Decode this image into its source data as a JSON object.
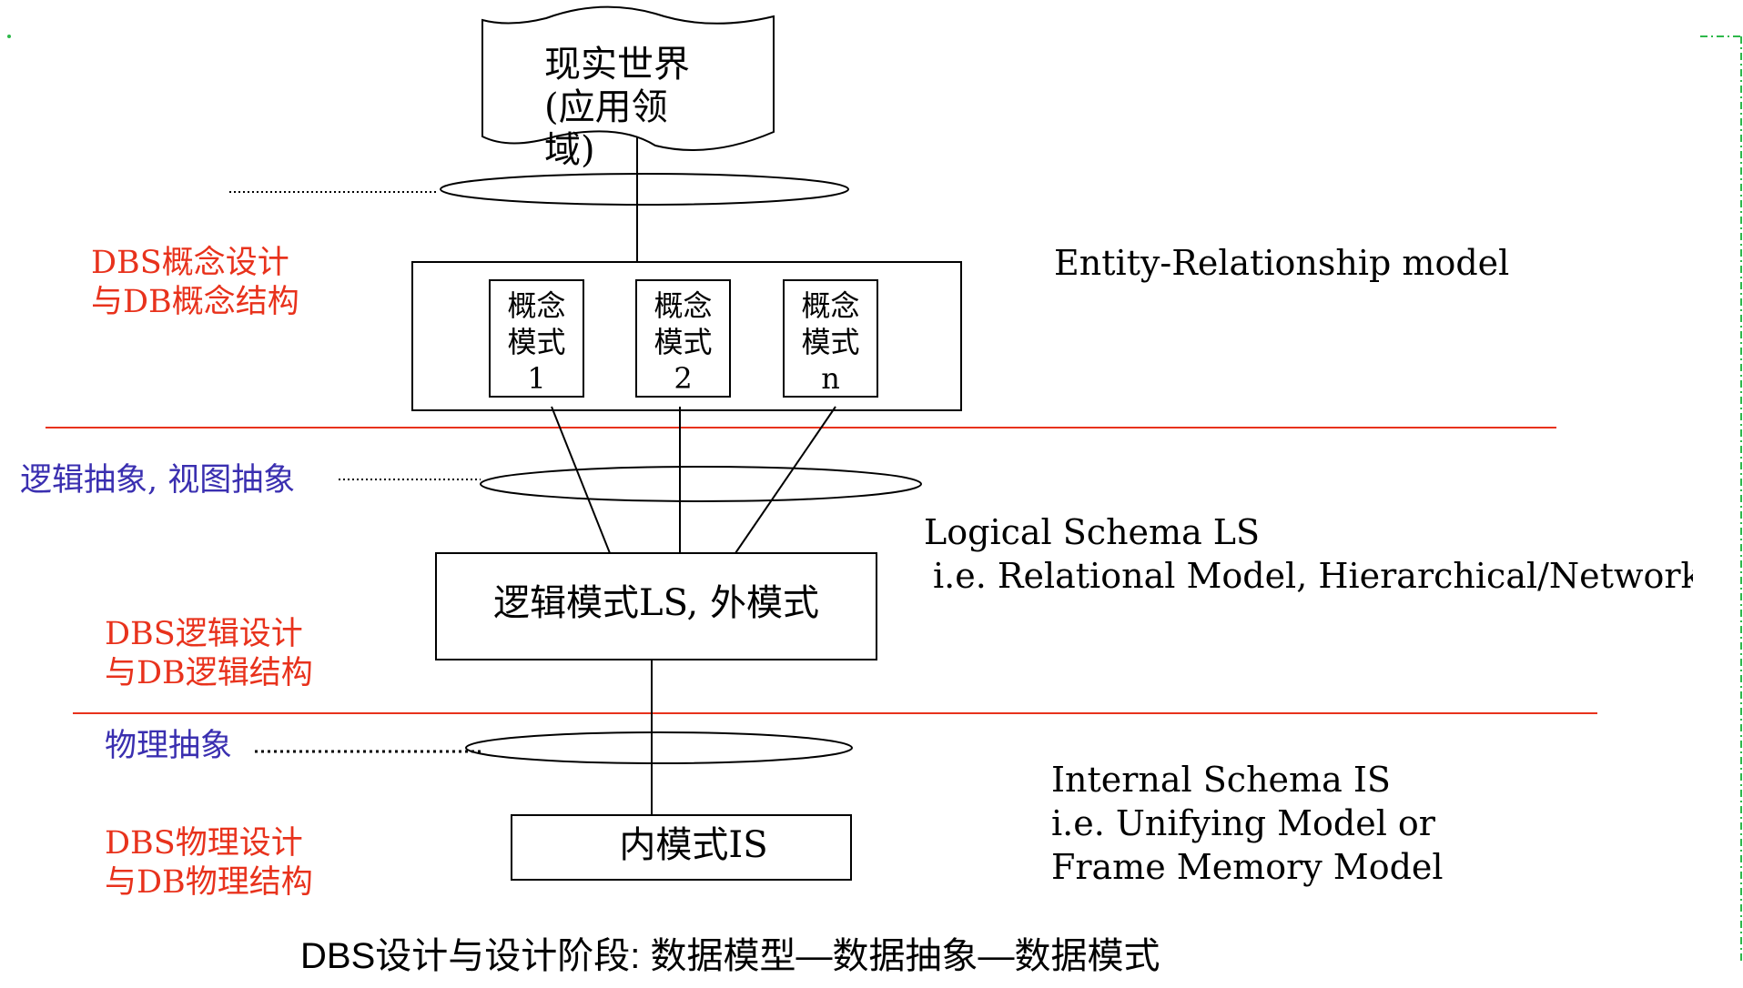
{
  "real_world": "现实世界\n(应用领\n域)",
  "left": {
    "conceptual_design": "DBS概念设计\n与DB概念结构",
    "logical_abstraction": "逻辑抽象, 视图抽象",
    "logical_design": "DBS逻辑设计\n与DB逻辑结构",
    "physical_abstraction": "物理抽象",
    "physical_design": "DBS物理设计\n与DB物理结构"
  },
  "conceptual_schemas": [
    {
      "label": "概念\n模式\n1"
    },
    {
      "label": "概念\n模式\n2"
    },
    {
      "label": "概念\n模式\nn"
    }
  ],
  "logical_box": "逻辑模式LS, 外模式",
  "internal_box": "内模式IS",
  "right": {
    "er_model": "Entity-Relationship model",
    "logical_schema_title": "Logical Schema  LS",
    "logical_schema_desc": "i.e. Relational  Model,   Hierarchical/Network",
    "internal_schema_title": "Internal Schema  IS",
    "internal_schema_desc1": "i.e. Unifying Model  or",
    "internal_schema_desc2": "Frame Memory Model"
  },
  "caption": "DBS设计与设计阶段:   数据模型—数据抽象—数据模式",
  "colors": {
    "red": "#e8321c",
    "blue": "#3a2fb0",
    "green": "#2db84a"
  }
}
